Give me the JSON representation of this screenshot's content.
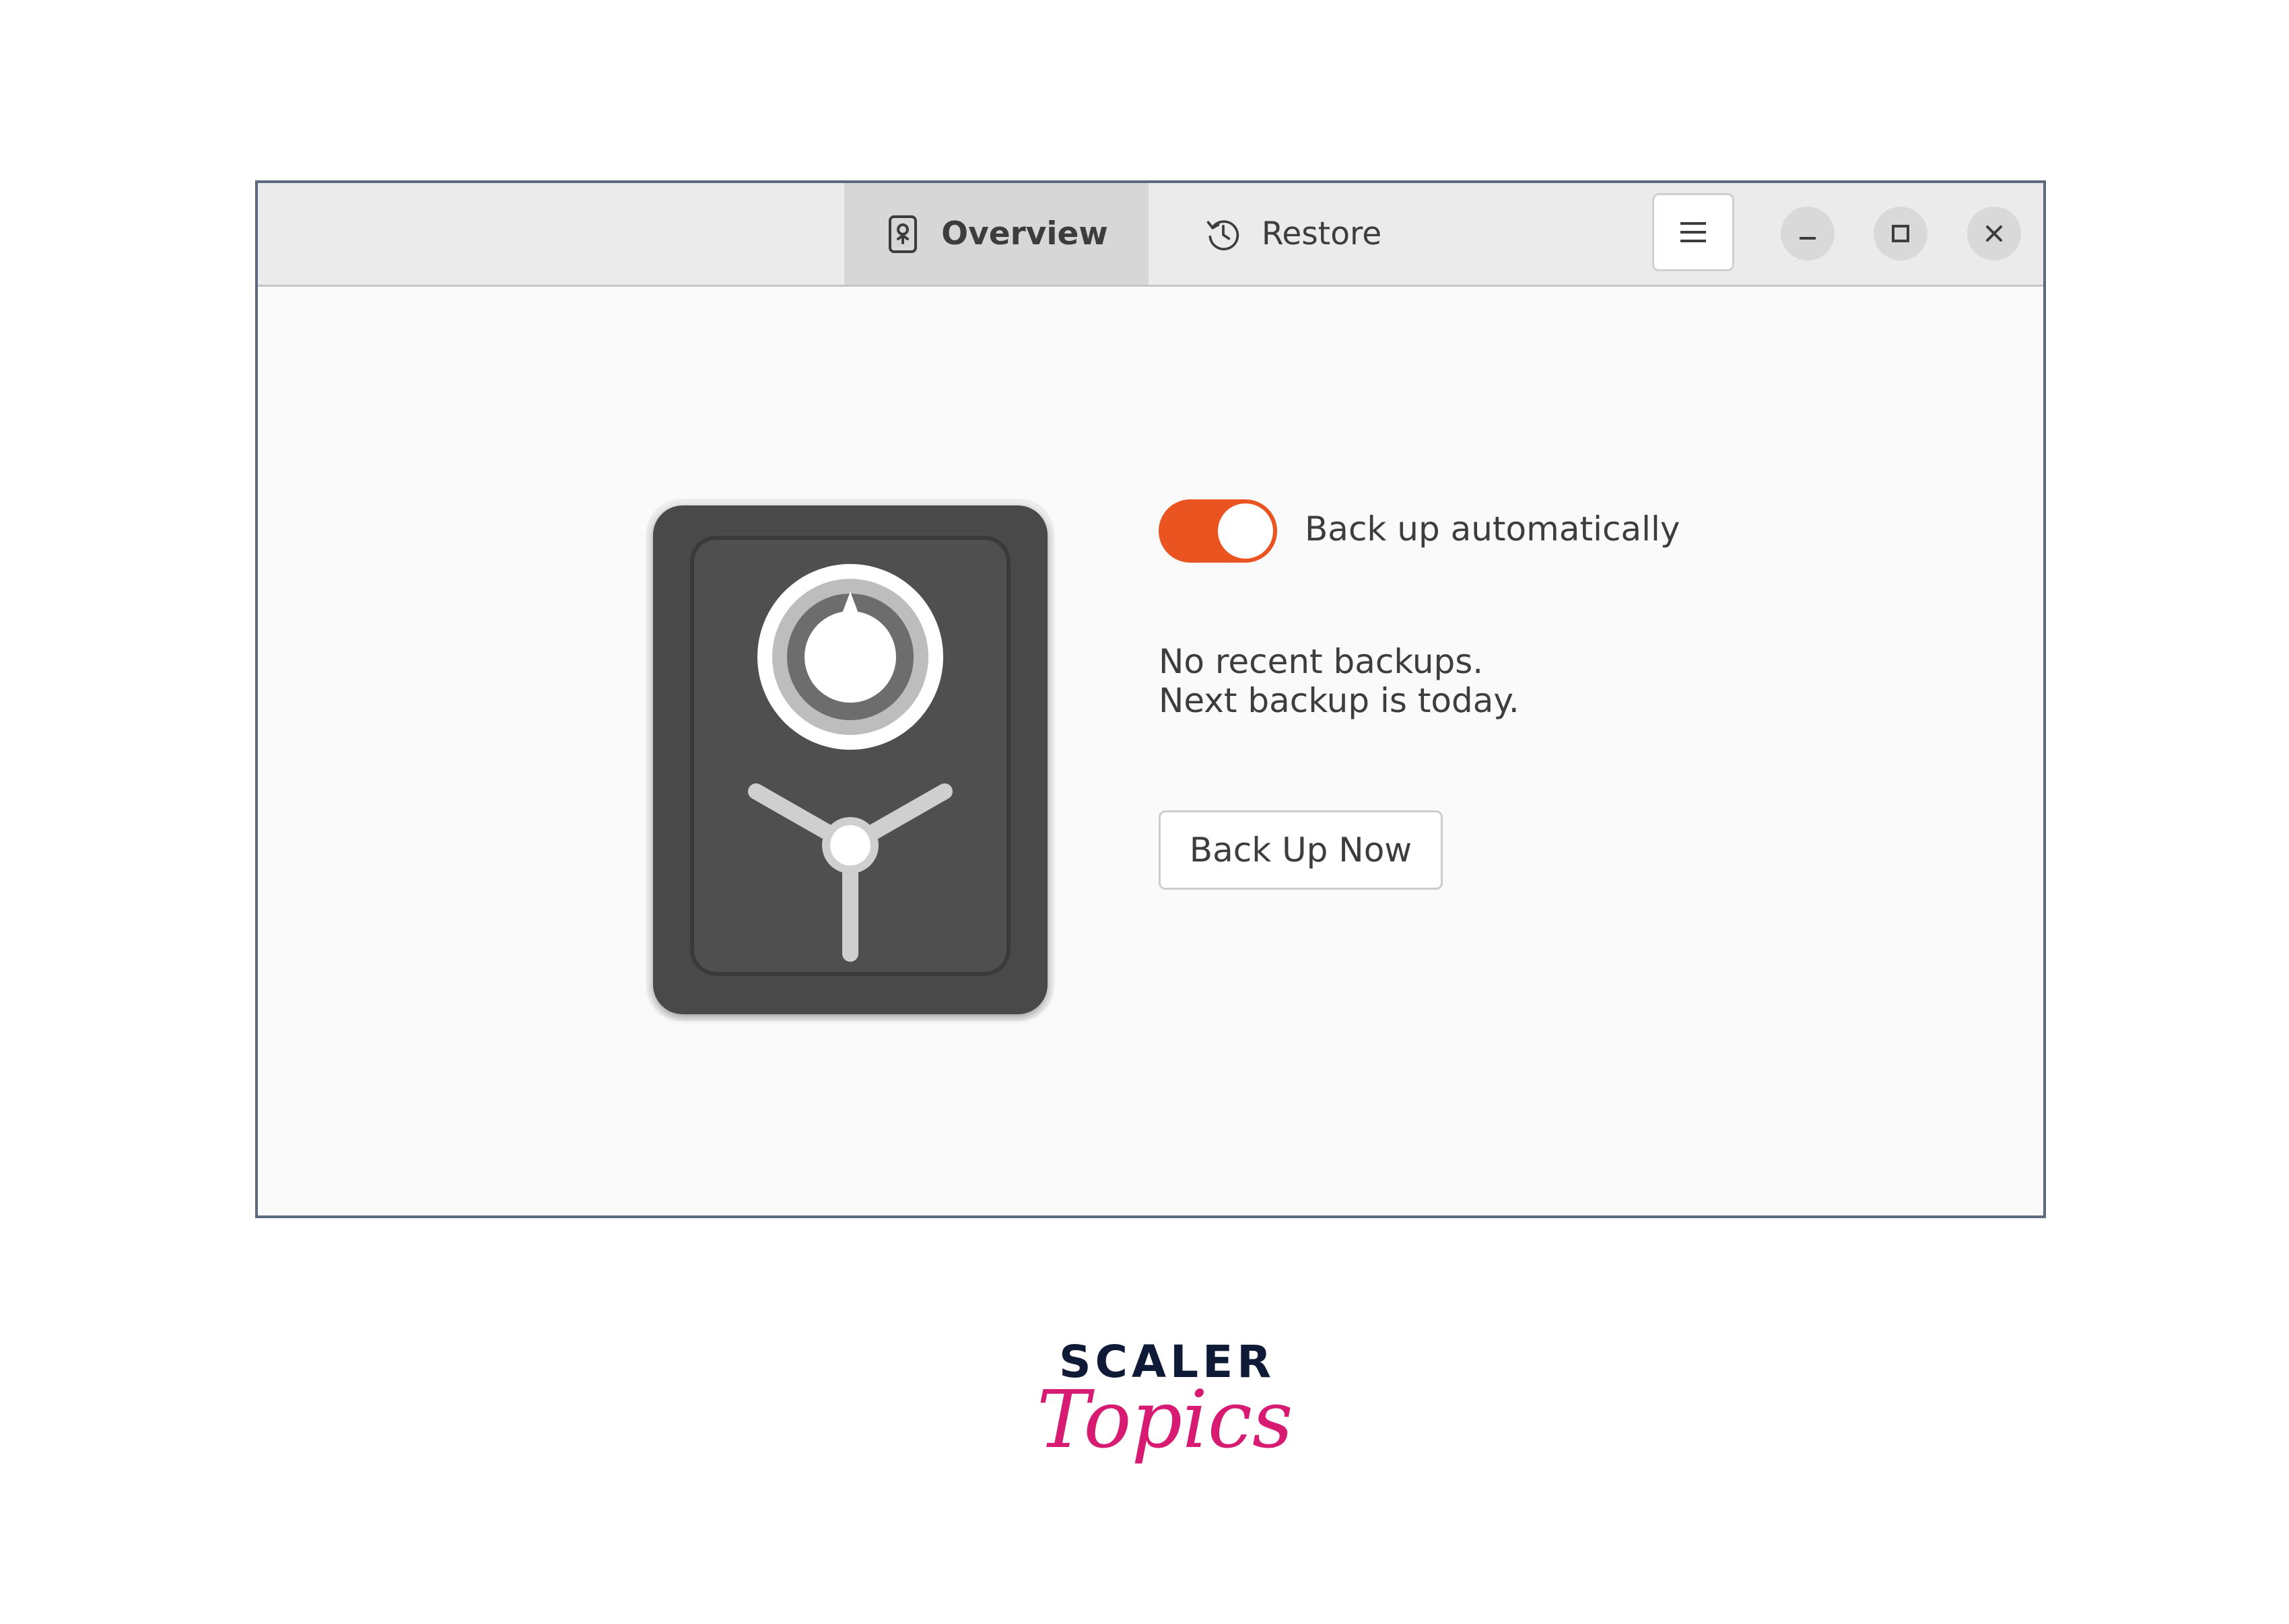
{
  "tabs": [
    {
      "label": "Overview",
      "icon": "safe-icon",
      "selected": true
    },
    {
      "label": "Restore",
      "icon": "history-icon",
      "selected": false
    }
  ],
  "window_controls": {
    "menu_icon": "hamburger-menu-icon",
    "minimize_icon": "minimize-icon",
    "maximize_icon": "maximize-icon",
    "close_icon": "close-icon"
  },
  "main": {
    "auto_backup": {
      "label": "Back up automatically",
      "enabled": true
    },
    "status_line1": "No recent backups.",
    "status_line2": "Next backup is today.",
    "backup_button": "Back Up Now",
    "illustration": "safe-illustration"
  },
  "logo": {
    "line1": "SCALER",
    "line2": "Topics"
  },
  "colors": {
    "accent": "#e95420",
    "headerbar": "#ebebeb",
    "selected_tab": "#d7d7d7",
    "content_bg": "#fafafa",
    "safe_body": "#4a4a4a",
    "logo_dark": "#0f1a36",
    "logo_pink": "#d81b72"
  }
}
